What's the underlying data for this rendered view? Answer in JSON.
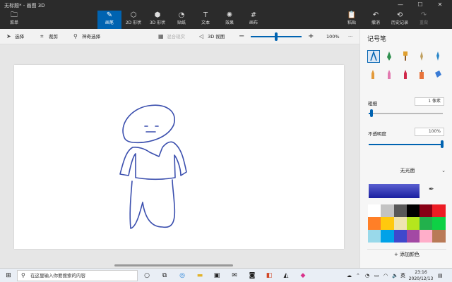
{
  "window": {
    "title": "无标题* - 画图 3D"
  },
  "toolbar": {
    "menu": "菜单",
    "brushes": "画笔",
    "shapes2d": "2D 形状",
    "shapes3d": "3D 形状",
    "stickers": "贴纸",
    "text": "文本",
    "effects": "效果",
    "canvas": "画布",
    "paste": "粘贴",
    "undo": "撤消",
    "history": "历史记录",
    "redo": "重做"
  },
  "subbar": {
    "select": "选择",
    "crop": "裁剪",
    "magic_select": "神奇选择",
    "mixed_reality": "混合现实",
    "view3d": "3D 视图",
    "zoom_value": "100%",
    "zoom_fraction": 0.5
  },
  "panel": {
    "title": "记号笔",
    "thickness_label": "粗细",
    "thickness_value": "1 像素",
    "opacity_label": "不透明度",
    "opacity_value": "100%",
    "finish": "无光面",
    "add_color": "添加颜色",
    "selected_color": "#3a3fbf",
    "swatches": [
      "#ffffff",
      "#c3c3c3",
      "#585858",
      "#000000",
      "#880015",
      "#ed1c24",
      "#ff7f27",
      "#ffc90e",
      "#efe4b0",
      "#b5e61d",
      "#22b14c",
      "#0ed145",
      "#99d9ea",
      "#00a2e8",
      "#3f48cc",
      "#a349a4",
      "#ffaec9",
      "#b97a57"
    ]
  },
  "taskbar": {
    "search_placeholder": "在这里输入你要搜索的内容",
    "ime": "英",
    "time": "23:16",
    "date": "2020/12/13"
  },
  "icons": {
    "app_menu": "folder-icon",
    "brush": "brush-icon"
  }
}
